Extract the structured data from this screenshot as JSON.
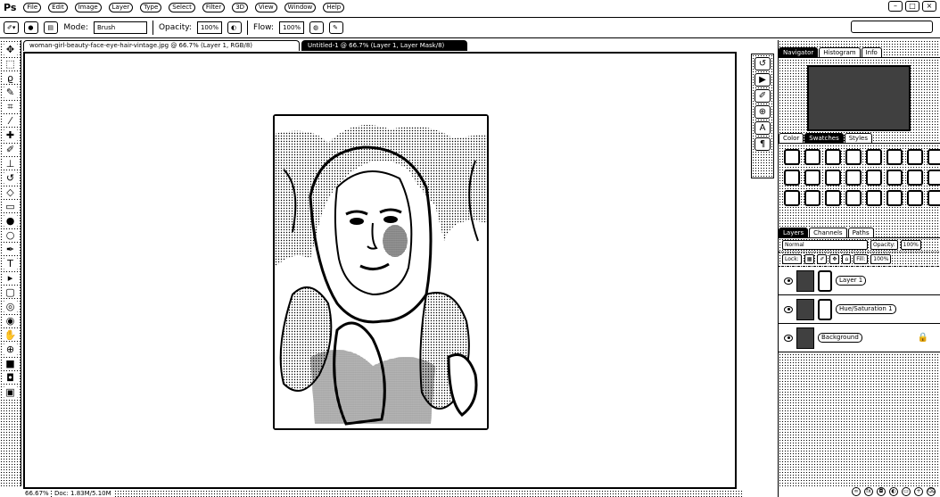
{
  "app": {
    "logo": "Ps"
  },
  "menubar": {
    "items": [
      "File",
      "Edit",
      "Image",
      "Layer",
      "Type",
      "Select",
      "Filter",
      "3D",
      "View",
      "Window",
      "Help"
    ],
    "window_controls": [
      "–",
      "□",
      "×"
    ]
  },
  "options": {
    "mode_label": "Mode:",
    "mode_value": "Brush",
    "opacity_label": "Opacity:",
    "opacity_value": "100%",
    "flow_label": "Flow:",
    "flow_value": "100%"
  },
  "toolbox": {
    "tools": [
      {
        "name": "move-tool",
        "glyph": "✥"
      },
      {
        "name": "marquee-tool",
        "glyph": "⬚"
      },
      {
        "name": "lasso-tool",
        "glyph": "ϱ"
      },
      {
        "name": "quick-select-tool",
        "glyph": "✎"
      },
      {
        "name": "crop-tool",
        "glyph": "⌗"
      },
      {
        "name": "eyedropper-tool",
        "glyph": "⁄"
      },
      {
        "name": "healing-tool",
        "glyph": "✚"
      },
      {
        "name": "brush-tool",
        "glyph": "✐"
      },
      {
        "name": "stamp-tool",
        "glyph": "⊥"
      },
      {
        "name": "history-brush-tool",
        "glyph": "↺"
      },
      {
        "name": "eraser-tool",
        "glyph": "◇"
      },
      {
        "name": "gradient-tool",
        "glyph": "▭"
      },
      {
        "name": "blur-tool",
        "glyph": "●"
      },
      {
        "name": "dodge-tool",
        "glyph": "○"
      },
      {
        "name": "pen-tool",
        "glyph": "✒"
      },
      {
        "name": "type-tool",
        "glyph": "T"
      },
      {
        "name": "path-select-tool",
        "glyph": "▸"
      },
      {
        "name": "shape-tool",
        "glyph": "▢"
      },
      {
        "name": "3d-rotate-tool",
        "glyph": "◎"
      },
      {
        "name": "3d-camera-tool",
        "glyph": "◉"
      },
      {
        "name": "hand-tool",
        "glyph": "✋"
      },
      {
        "name": "zoom-tool",
        "glyph": "⊕"
      },
      {
        "name": "color-swatch",
        "glyph": "■"
      },
      {
        "name": "quick-mask",
        "glyph": "◘"
      },
      {
        "name": "screen-mode",
        "glyph": "▣"
      }
    ]
  },
  "documents": {
    "tabs": [
      {
        "label": "woman-girl-beauty-face-eye-hair-vintage.jpg @ 66.7% (Layer 1, RGB/8)",
        "active": false
      },
      {
        "label": "Untitled-1 @ 66.7% (Layer 1, Layer Mask/8)",
        "active": true
      }
    ]
  },
  "status": {
    "zoom": "66.67%",
    "doc_info": "Doc: 1.83M/5.10M"
  },
  "mini_dock": {
    "icons": [
      "history-icon",
      "actions-icon",
      "brush-preset-icon",
      "clone-source-icon",
      "character-icon",
      "paragraph-icon"
    ]
  },
  "panels": {
    "navigator_tabs": [
      "Navigator",
      "Histogram",
      "Info"
    ],
    "swatch_tabs": [
      "Color",
      "Swatches",
      "Styles"
    ],
    "layers_tabs": [
      "Layers",
      "Channels",
      "Paths"
    ],
    "blend_mode": "Normal",
    "opacity_label": "Opacity:",
    "opacity_value": "100%",
    "lock_label": "Lock:",
    "fill_label": "Fill:",
    "fill_value": "100%",
    "layers": [
      {
        "name": "Layer 1",
        "has_mask": true
      },
      {
        "name": "Hue/Saturation 1",
        "has_mask": true
      },
      {
        "name": "Background",
        "has_mask": false
      }
    ]
  }
}
